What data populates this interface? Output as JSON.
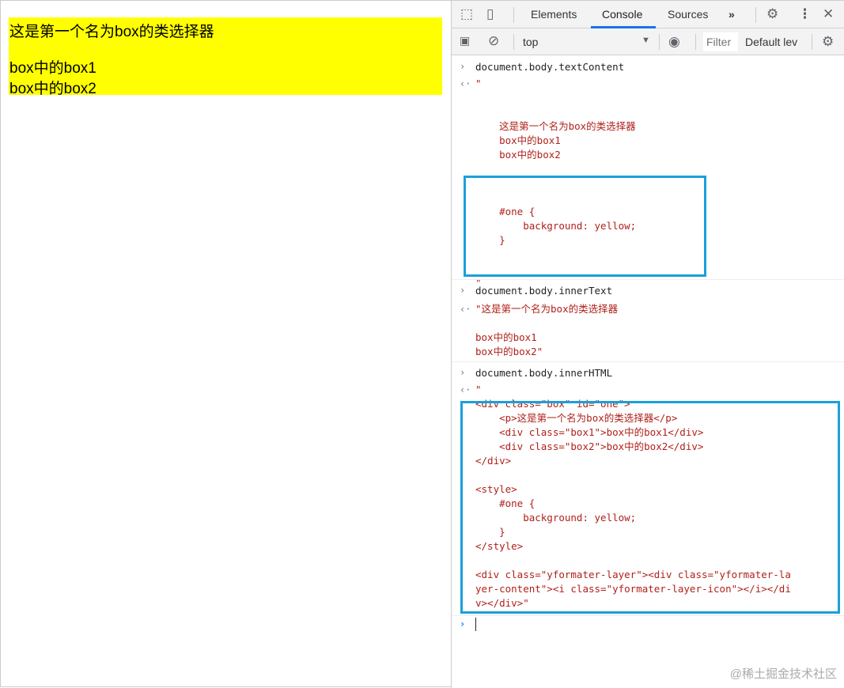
{
  "page": {
    "p": "这是第一个名为box的类选择器",
    "box1": "box中的box1",
    "box2": "box中的box2"
  },
  "devtools": {
    "tabs": [
      "Elements",
      "Console",
      "Sources"
    ],
    "more": "»",
    "context": "top",
    "filter_placeholder": "Filter",
    "levels": "Default lev"
  },
  "console": [
    {
      "input": "document.body.textContent",
      "output": "\"\n\n\n    这是第一个名为box的类选择器\n    box中的box1\n    box中的box2\n\n\n\n    #one {\n        background: yellow;\n    }\n\n\n\""
    },
    {
      "input": "document.body.innerText",
      "output": "\"这是第一个名为box的类选择器\n\nbox中的box1\nbox中的box2\""
    },
    {
      "input": "document.body.innerHTML",
      "output": "\"\n<div class=\"box\" id=\"one\">\n    <p>这是第一个名为box的类选择器</p>\n    <div class=\"box1\">box中的box1</div>\n    <div class=\"box2\">box中的box2</div>\n</div>\n\n<style>\n    #one {\n        background: yellow;\n    }\n</style>\n\n<div class=\"yformater-layer\"><div class=\"yformater-la\nyer-content\"><i class=\"yformater-layer-icon\"></i></di\nv></div>\""
    }
  ],
  "watermark": "@稀土掘金技术社区",
  "colors": {
    "highlight": "#1aa0d8",
    "output": "#b0211b",
    "tab_underline": "#1a73e8",
    "yellow": "#ffff00"
  }
}
